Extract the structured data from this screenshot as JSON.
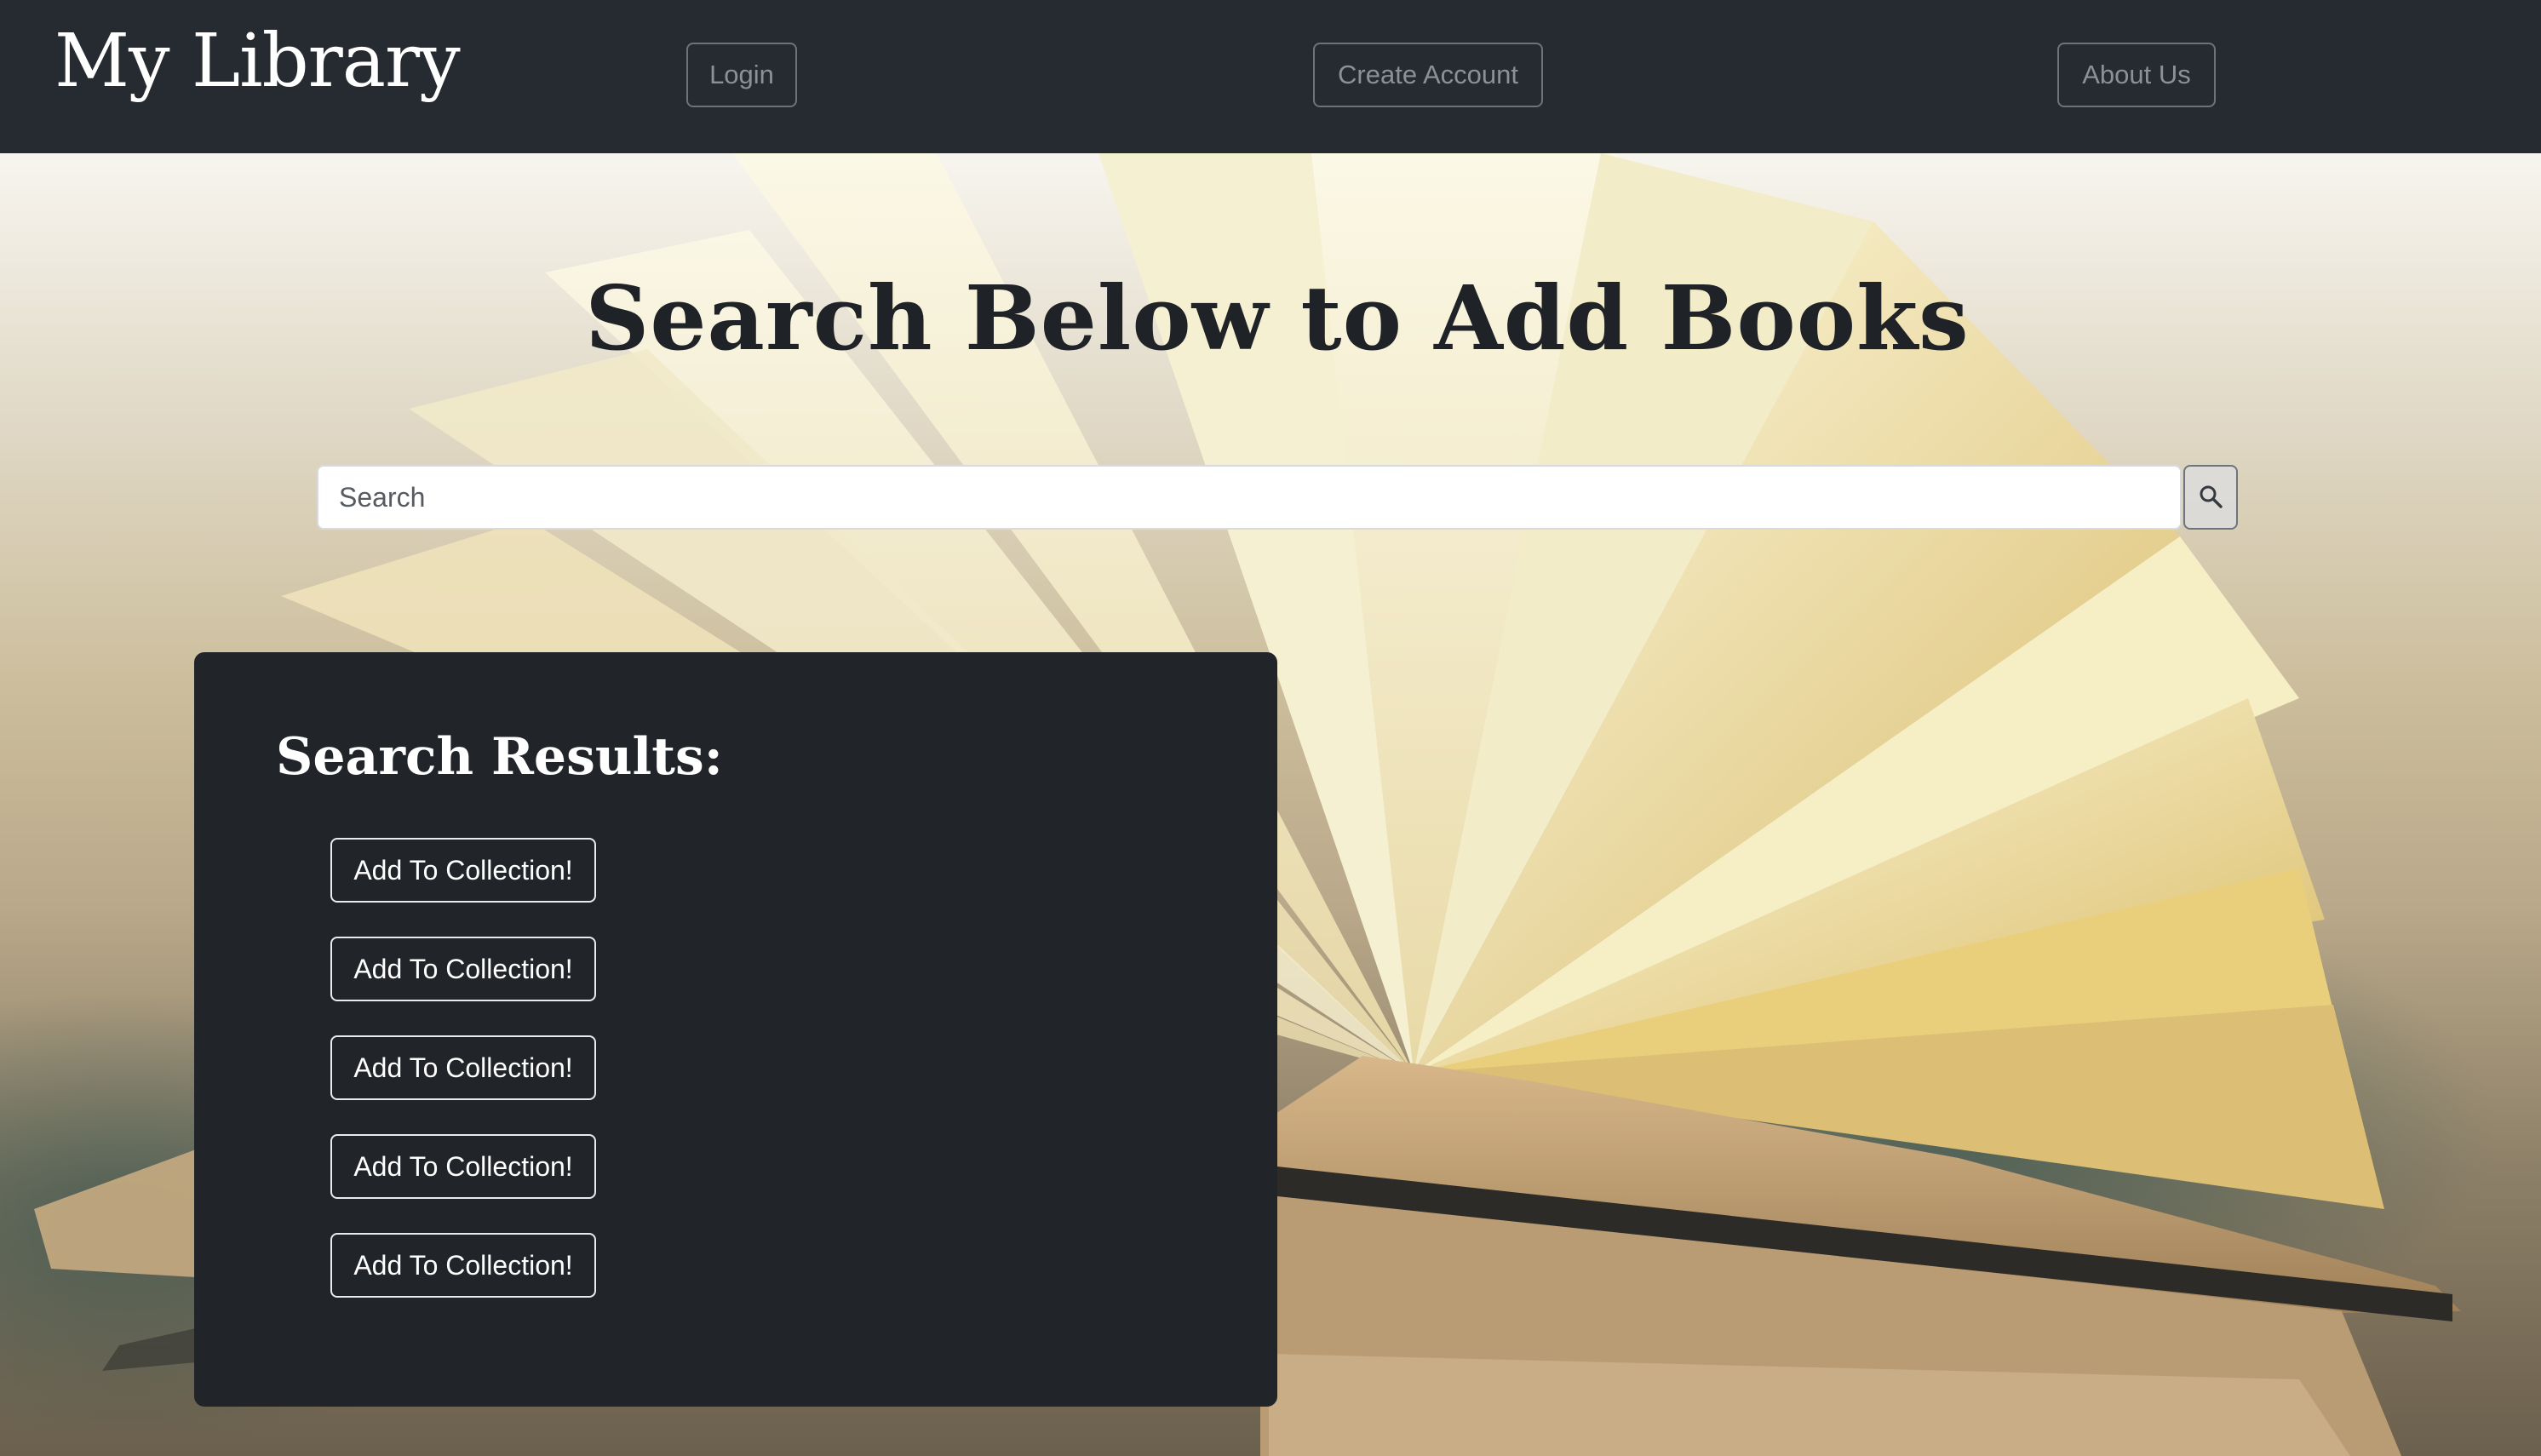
{
  "nav": {
    "brand": "My Library",
    "login_label": "Login",
    "create_account_label": "Create Account",
    "about_label": "About Us"
  },
  "hero": {
    "title": "Search Below to Add Books"
  },
  "search": {
    "placeholder": "Search",
    "value": "",
    "button_icon": "search-icon"
  },
  "results": {
    "title": "Search Results:",
    "items": [
      {
        "button_label": "Add To Collection!"
      },
      {
        "button_label": "Add To Collection!"
      },
      {
        "button_label": "Add To Collection!"
      },
      {
        "button_label": "Add To Collection!"
      },
      {
        "button_label": "Add To Collection!"
      }
    ]
  },
  "colors": {
    "navbar_bg": "#262a31",
    "panel_bg": "#212429",
    "nav_button_text": "#8b9197",
    "title_text": "#1f2226"
  }
}
